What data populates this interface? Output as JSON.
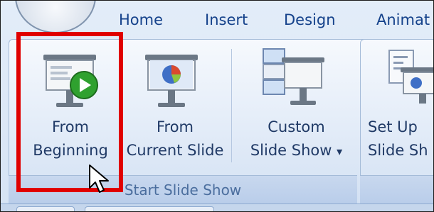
{
  "tabs": [
    {
      "label": "Home"
    },
    {
      "label": "Insert"
    },
    {
      "label": "Design"
    },
    {
      "label": "Animat"
    }
  ],
  "buttons": {
    "from_beginning": {
      "line1": "From",
      "line2": "Beginning"
    },
    "from_current": {
      "line1": "From",
      "line2": "Current Slide"
    },
    "custom_show": {
      "line1": "Custom",
      "line2": "Slide Show",
      "arrow": "▾"
    },
    "setup": {
      "line1": "Set Up",
      "line2": "Slide Sh"
    }
  },
  "group_label": "Start Slide Show",
  "colors": {
    "tab_text": "#15428b",
    "highlight": "#e00000",
    "play_green": "#2fa12f"
  },
  "icons": [
    "office-button-icon",
    "projector-screen-icon",
    "play-icon",
    "pie-chart-icon",
    "custom-show-icon",
    "setup-icon",
    "mouse-pointer-icon"
  ]
}
